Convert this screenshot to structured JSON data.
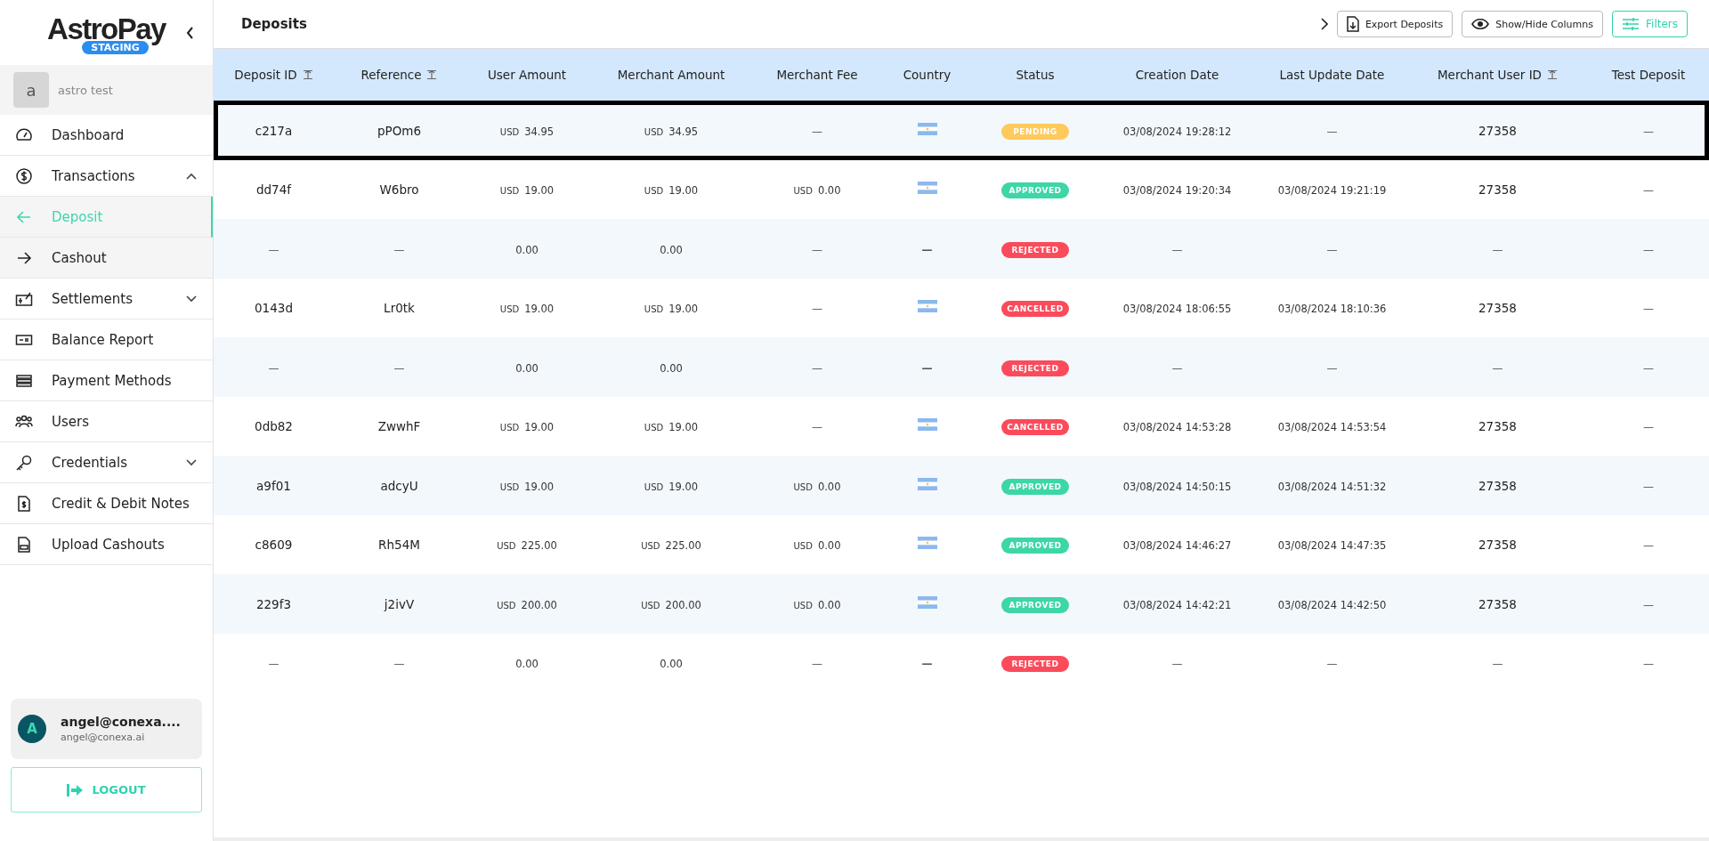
{
  "sidebar": {
    "logo": {
      "brand": "AstroPay",
      "badge": "STAGING"
    },
    "workspace": {
      "avatar": "a",
      "name": "astro test"
    },
    "items": [
      {
        "label": "Dashboard",
        "selected": false
      },
      {
        "label": "Transactions",
        "selected": false,
        "expanded": true,
        "children": [
          {
            "label": "Deposit",
            "selected": true
          },
          {
            "label": "Cashout",
            "selected": false
          }
        ]
      },
      {
        "label": "Settlements",
        "selected": false,
        "expanded": false
      },
      {
        "label": "Balance Report",
        "selected": false
      },
      {
        "label": "Payment Methods",
        "selected": false
      },
      {
        "label": "Users",
        "selected": false
      },
      {
        "label": "Credentials",
        "selected": false,
        "expanded": false
      },
      {
        "label": "Credit & Debit Notes",
        "selected": false
      },
      {
        "label": "Upload Cashouts",
        "selected": false
      }
    ],
    "account": {
      "avatar": "A",
      "name": "angel@conexa....",
      "email": "angel@conexa.ai"
    },
    "logout": "LOGOUT"
  },
  "header": {
    "title": "Deposits",
    "buttons": [
      {
        "label": "Export Deposits",
        "kind": "export"
      },
      {
        "label": "Show/Hide Columns",
        "kind": "columns"
      },
      {
        "label": "Filters",
        "kind": "filters"
      }
    ]
  },
  "table": {
    "columns": [
      {
        "label": "Deposit ID",
        "sortable": true
      },
      {
        "label": "Reference",
        "sortable": true
      },
      {
        "label": "User Amount",
        "sortable": false
      },
      {
        "label": "Merchant Amount",
        "sortable": false
      },
      {
        "label": "Merchant Fee",
        "sortable": false
      },
      {
        "label": "Country",
        "sortable": false
      },
      {
        "label": "Status",
        "sortable": false
      },
      {
        "label": "Creation Date",
        "sortable": false
      },
      {
        "label": "Last Update Date",
        "sortable": false
      },
      {
        "label": "Merchant User ID",
        "sortable": true
      },
      {
        "label": "Test Deposit",
        "sortable": false
      }
    ],
    "rows": [
      {
        "selected": true,
        "deposit_id": "c217a",
        "reference": "pPOm6",
        "user_amount": {
          "currency": "USD",
          "value": "34.95"
        },
        "merchant_amount": {
          "currency": "USD",
          "value": "34.95"
        },
        "merchant_fee": {
          "value": "—"
        },
        "country": {
          "kind": "flag"
        },
        "status": {
          "kind": "pending",
          "label": "PENDING"
        },
        "creation_date": "03/08/2024 19:28:12",
        "last_update_date": "—",
        "merchant_user_id": "27358",
        "test_deposit": "—"
      },
      {
        "selected": false,
        "deposit_id": "dd74f",
        "reference": "W6bro",
        "user_amount": {
          "currency": "USD",
          "value": "19.00"
        },
        "merchant_amount": {
          "currency": "USD",
          "value": "19.00"
        },
        "merchant_fee": {
          "currency": "USD",
          "value": "0.00"
        },
        "country": {
          "kind": "flag"
        },
        "status": {
          "kind": "approved",
          "label": "APPROVED"
        },
        "creation_date": "03/08/2024 19:20:34",
        "last_update_date": "03/08/2024 19:21:19",
        "merchant_user_id": "27358",
        "test_deposit": "—"
      },
      {
        "selected": false,
        "deposit_id": "—",
        "reference": "—",
        "user_amount": {
          "value": "0.00"
        },
        "merchant_amount": {
          "value": "0.00"
        },
        "merchant_fee": {
          "value": "—"
        },
        "country": {
          "kind": "text",
          "text": "—"
        },
        "status": {
          "kind": "rejected",
          "label": "REJECTED"
        },
        "creation_date": "—",
        "last_update_date": "—",
        "merchant_user_id": "—",
        "test_deposit": "—"
      },
      {
        "selected": false,
        "deposit_id": "0143d",
        "reference": "Lr0tk",
        "user_amount": {
          "currency": "USD",
          "value": "19.00"
        },
        "merchant_amount": {
          "currency": "USD",
          "value": "19.00"
        },
        "merchant_fee": {
          "value": "—"
        },
        "country": {
          "kind": "flag"
        },
        "status": {
          "kind": "cancelled",
          "label": "CANCELLED"
        },
        "creation_date": "03/08/2024 18:06:55",
        "last_update_date": "03/08/2024 18:10:36",
        "merchant_user_id": "27358",
        "test_deposit": "—"
      },
      {
        "selected": false,
        "deposit_id": "—",
        "reference": "—",
        "user_amount": {
          "value": "0.00"
        },
        "merchant_amount": {
          "value": "0.00"
        },
        "merchant_fee": {
          "value": "—"
        },
        "country": {
          "kind": "text",
          "text": "—"
        },
        "status": {
          "kind": "rejected",
          "label": "REJECTED"
        },
        "creation_date": "—",
        "last_update_date": "—",
        "merchant_user_id": "—",
        "test_deposit": "—"
      },
      {
        "selected": false,
        "deposit_id": "0db82",
        "reference": "ZwwhF",
        "user_amount": {
          "currency": "USD",
          "value": "19.00"
        },
        "merchant_amount": {
          "currency": "USD",
          "value": "19.00"
        },
        "merchant_fee": {
          "value": "—"
        },
        "country": {
          "kind": "flag"
        },
        "status": {
          "kind": "cancelled",
          "label": "CANCELLED"
        },
        "creation_date": "03/08/2024 14:53:28",
        "last_update_date": "03/08/2024 14:53:54",
        "merchant_user_id": "27358",
        "test_deposit": "—"
      },
      {
        "selected": false,
        "deposit_id": "a9f01",
        "reference": "adcyU",
        "user_amount": {
          "currency": "USD",
          "value": "19.00"
        },
        "merchant_amount": {
          "currency": "USD",
          "value": "19.00"
        },
        "merchant_fee": {
          "currency": "USD",
          "value": "0.00"
        },
        "country": {
          "kind": "flag"
        },
        "status": {
          "kind": "approved",
          "label": "APPROVED"
        },
        "creation_date": "03/08/2024 14:50:15",
        "last_update_date": "03/08/2024 14:51:32",
        "merchant_user_id": "27358",
        "test_deposit": "—"
      },
      {
        "selected": false,
        "deposit_id": "c8609",
        "reference": "Rh54M",
        "user_amount": {
          "currency": "USD",
          "value": "225.00"
        },
        "merchant_amount": {
          "currency": "USD",
          "value": "225.00"
        },
        "merchant_fee": {
          "currency": "USD",
          "value": "0.00"
        },
        "country": {
          "kind": "flag"
        },
        "status": {
          "kind": "approved",
          "label": "APPROVED"
        },
        "creation_date": "03/08/2024 14:46:27",
        "last_update_date": "03/08/2024 14:47:35",
        "merchant_user_id": "27358",
        "test_deposit": "—"
      },
      {
        "selected": false,
        "deposit_id": "229f3",
        "reference": "j2ivV",
        "user_amount": {
          "currency": "USD",
          "value": "200.00"
        },
        "merchant_amount": {
          "currency": "USD",
          "value": "200.00"
        },
        "merchant_fee": {
          "currency": "USD",
          "value": "0.00"
        },
        "country": {
          "kind": "flag"
        },
        "status": {
          "kind": "approved",
          "label": "APPROVED"
        },
        "creation_date": "03/08/2024 14:42:21",
        "last_update_date": "03/08/2024 14:42:50",
        "merchant_user_id": "27358",
        "test_deposit": "—"
      },
      {
        "selected": false,
        "deposit_id": "—",
        "reference": "—",
        "user_amount": {
          "value": "0.00"
        },
        "merchant_amount": {
          "value": "0.00"
        },
        "merchant_fee": {
          "value": "—"
        },
        "country": {
          "kind": "text",
          "text": "—"
        },
        "status": {
          "kind": "rejected",
          "label": "REJECTED"
        },
        "creation_date": "—",
        "last_update_date": "—",
        "merchant_user_id": "—",
        "test_deposit": "—"
      }
    ]
  }
}
